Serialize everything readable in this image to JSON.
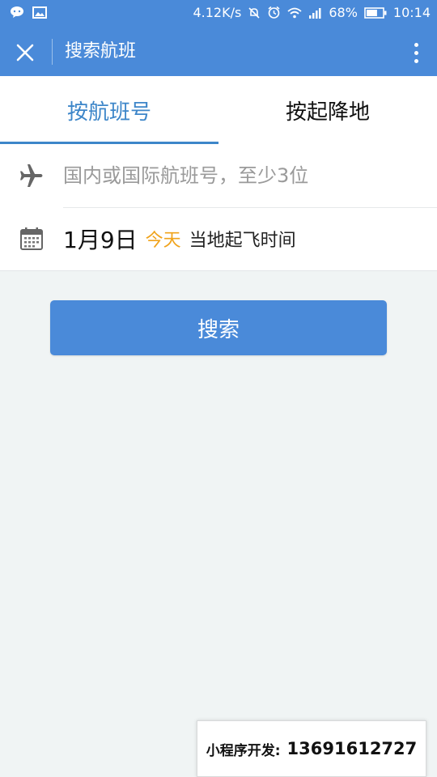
{
  "status_bar": {
    "left_icons": [
      "chat-bubble-icon",
      "image-icon"
    ],
    "network_speed": "4.12K/s",
    "right_icons": [
      "mute-icon",
      "alarm-icon",
      "wifi-icon",
      "signal-icon"
    ],
    "battery_percent": "68%",
    "battery_level": 0.68,
    "time": "10:14"
  },
  "app_bar": {
    "title": "搜索航班",
    "close_icon": "close-icon",
    "more_icon": "more-vertical-icon"
  },
  "tabs": [
    {
      "label": "按航班号",
      "active": true
    },
    {
      "label": "按起降地",
      "active": false
    }
  ],
  "form": {
    "flight_number": {
      "icon": "airplane-icon",
      "value": "",
      "placeholder": "国内或国际航班号，至少3位"
    },
    "date": {
      "icon": "calendar-icon",
      "date": "1月9日",
      "today_label": "今天",
      "note": "当地起飞时间"
    }
  },
  "search_button": {
    "label": "搜索"
  },
  "promo": {
    "label": "小程序开发:",
    "phone": "13691612727"
  },
  "colors": {
    "primary": "#4a8ad9",
    "tab_active": "#3d86c9",
    "today_accent": "#f0a31b",
    "background": "#f0f4f4"
  }
}
